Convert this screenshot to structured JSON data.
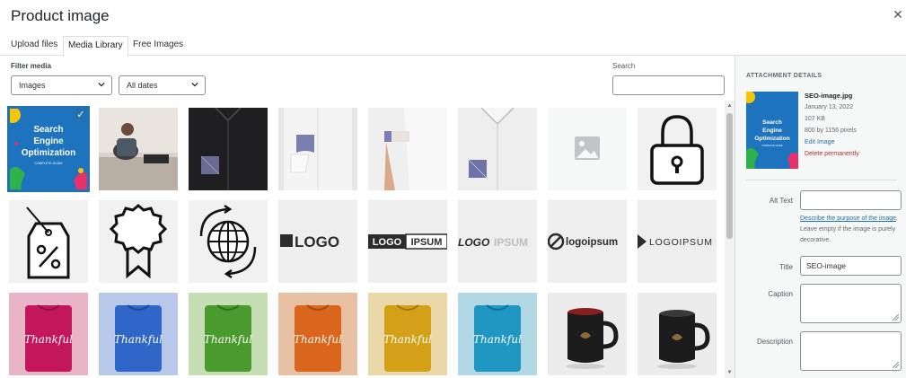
{
  "modal": {
    "title": "Product image",
    "close_icon": "close-icon"
  },
  "tabs": [
    {
      "label": "Upload files",
      "active": false
    },
    {
      "label": "Media Library",
      "active": true
    },
    {
      "label": "Free Images",
      "active": false
    }
  ],
  "filter": {
    "label": "Filter media",
    "type_select": "Images",
    "date_select": "All dates"
  },
  "search": {
    "label": "Search",
    "value": ""
  },
  "thumbnails": {
    "seo": {
      "line1": "Search",
      "line2": "Engine",
      "line3": "Optimization",
      "caption": "COMPLETE GUIDE"
    },
    "logos": [
      "LOGO",
      "LOGO",
      "IPSUM",
      "LOGO",
      "IPSUM",
      "logoipsum",
      "LOGOIPSUM"
    ],
    "shirt_text": "Thankful"
  },
  "attachment": {
    "heading": "ATTACHMENT DETAILS",
    "filename": "SEO-image.jpg",
    "date": "January 13, 2022",
    "size": "107 KB",
    "dimensions": "800 by 1156 pixels",
    "edit_link": "Edit Image",
    "delete_link": "Delete permanently",
    "alt_label": "Alt Text",
    "alt_value": "",
    "help_link": "Describe the purpose of the image",
    "help_text": ". Leave empty if the image is purely decorative.",
    "title_label": "Title",
    "title_value": "SEO-image",
    "caption_label": "Caption",
    "caption_value": "",
    "description_label": "Description",
    "description_value": ""
  },
  "colors": {
    "accent": "#2271b1",
    "delete": "#b32d2e",
    "seo_bg": "#1e73be",
    "shirts": [
      "#c2185b",
      "#2f66c8",
      "#4a9b2e",
      "#d9661c",
      "#d4a017",
      "#1f97c2"
    ],
    "shirt_bgs": [
      "#e8b4c6",
      "#b8c8ea",
      "#c6deb4",
      "#e8c0a2",
      "#ead8a8",
      "#b2d8e6"
    ]
  }
}
